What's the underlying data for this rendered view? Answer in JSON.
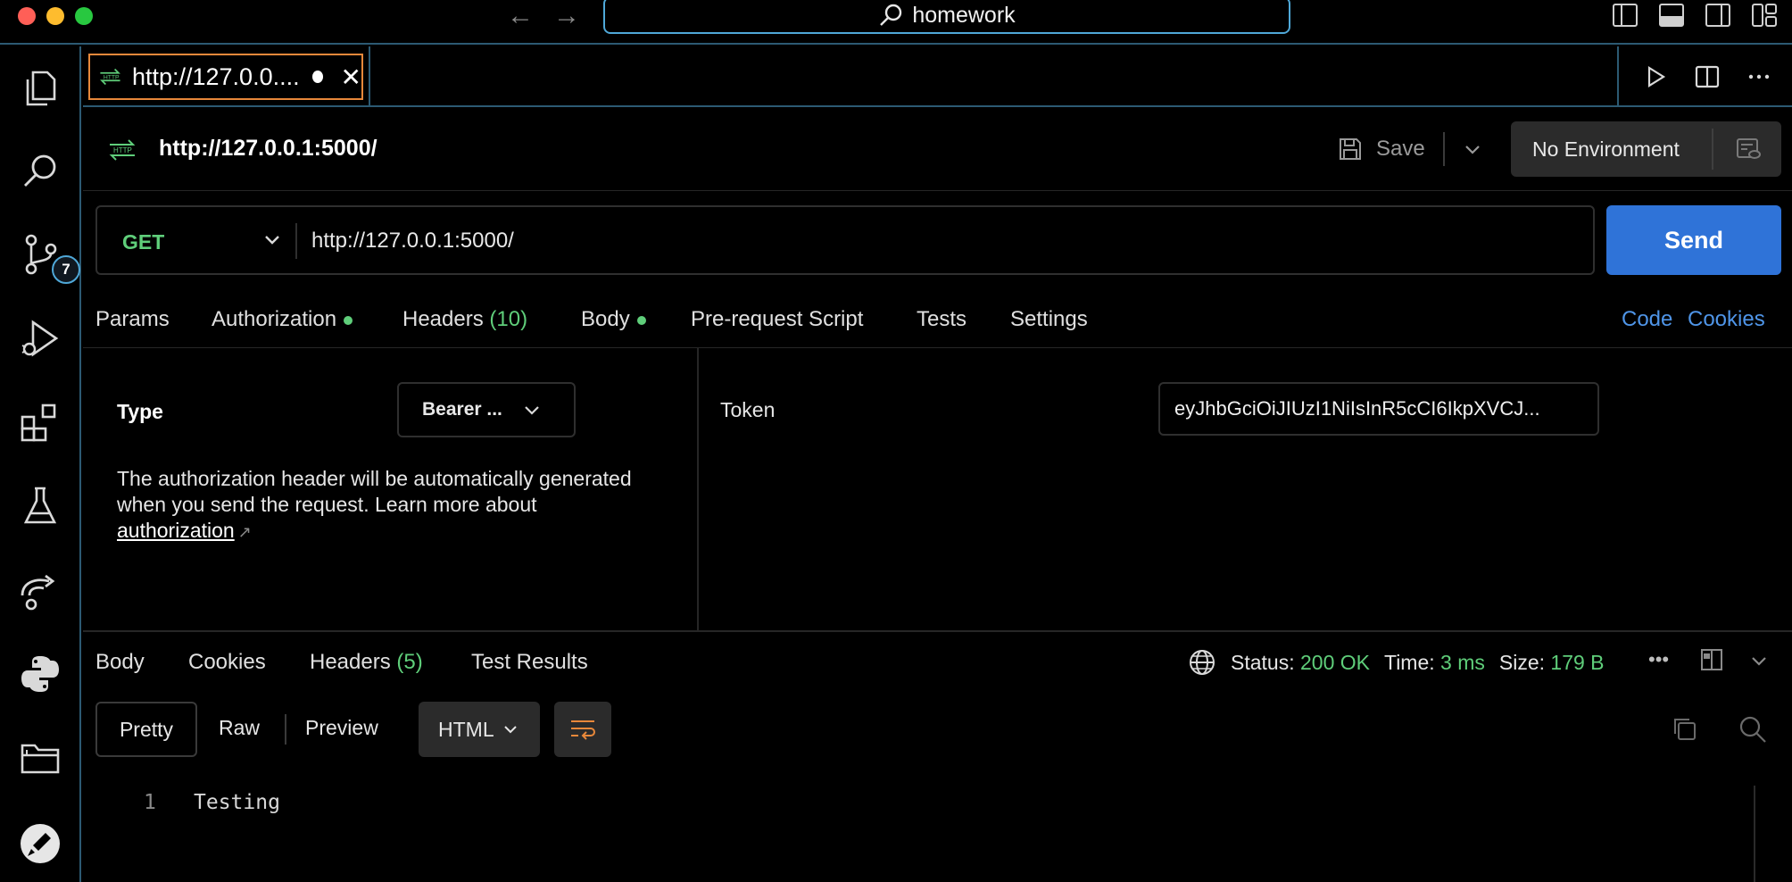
{
  "window": {
    "search_text": "homework"
  },
  "activity_bar": {
    "items": [
      {
        "name": "explorer",
        "icon": "files-icon"
      },
      {
        "name": "search",
        "icon": "search-icon"
      },
      {
        "name": "source-control",
        "icon": "source-control-icon",
        "badge": "7"
      },
      {
        "name": "run-debug",
        "icon": "run-debug-icon"
      },
      {
        "name": "extensions",
        "icon": "extensions-icon"
      },
      {
        "name": "testing",
        "icon": "flask-icon"
      },
      {
        "name": "remote",
        "icon": "remote-icon"
      },
      {
        "name": "python",
        "icon": "python-icon"
      },
      {
        "name": "folders",
        "icon": "folder-icon"
      },
      {
        "name": "postman",
        "icon": "postman-icon"
      }
    ]
  },
  "editor_tab": {
    "label": "http://127.0.0....",
    "icon": "http-icon"
  },
  "request": {
    "title": "http://127.0.0.1:5000/",
    "save_label": "Save",
    "environment": "No Environment",
    "method": "GET",
    "url": "http://127.0.0.1:5000/",
    "send_label": "Send"
  },
  "request_tabs": {
    "params": "Params",
    "authorization": "Authorization",
    "headers": "Headers",
    "headers_count": "(10)",
    "body": "Body",
    "pre_request": "Pre-request Script",
    "tests": "Tests",
    "settings": "Settings",
    "code": "Code",
    "cookies": "Cookies"
  },
  "auth": {
    "type_label": "Type",
    "type_value": "Bearer ...",
    "description": "The authorization header will be automatically generated when you send the request. Learn more about",
    "link_text": "authorization",
    "token_label": "Token",
    "token_value": "eyJhbGciOiJIUzI1NiIsInR5cCI6IkpXVCJ..."
  },
  "response": {
    "tabs": {
      "body": "Body",
      "cookies": "Cookies",
      "headers": "Headers",
      "headers_count": "(5)",
      "test_results": "Test Results"
    },
    "status_label": "Status:",
    "status_value": "200 OK",
    "time_label": "Time:",
    "time_value": "3 ms",
    "size_label": "Size:",
    "size_value": "179 B",
    "more": "•••",
    "view": {
      "pretty": "Pretty",
      "raw": "Raw",
      "preview": "Preview",
      "format": "HTML"
    },
    "lines": [
      {
        "number": "1",
        "text": "Testing"
      }
    ]
  },
  "colors": {
    "accent_blue": "#2f73d8",
    "success_green": "#5fce7a",
    "tab_border_orange": "#e8883a",
    "frame_border": "#2c5a73"
  }
}
